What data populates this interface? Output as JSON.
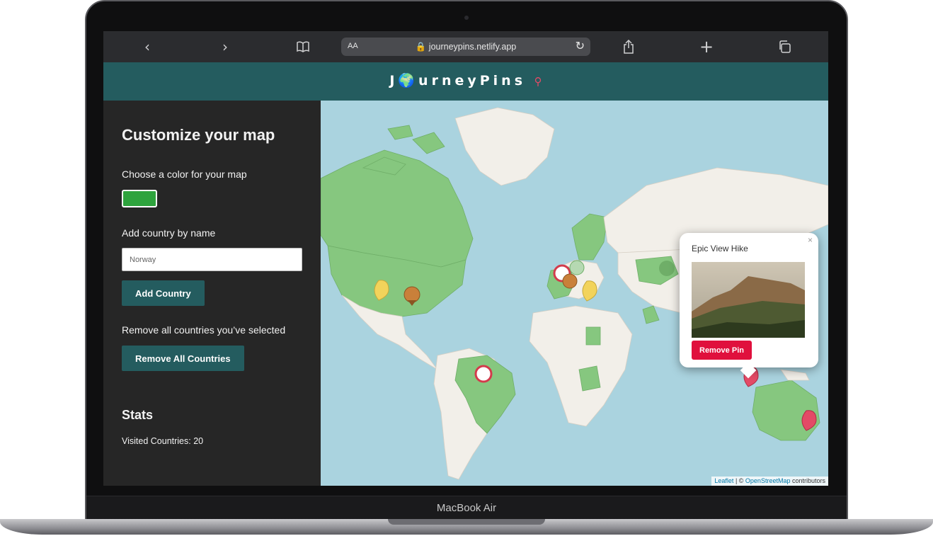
{
  "browser": {
    "text_size_label": "AA",
    "url": "journeypins.netlify.app",
    "icons": [
      "back-icon",
      "forward-icon",
      "bookmarks-icon",
      "lock-icon",
      "reload-icon",
      "share-icon",
      "new-tab-icon",
      "tabs-icon"
    ]
  },
  "header": {
    "logo_text": "J🌍urneyPins"
  },
  "sidebar": {
    "title": "Customize your map",
    "color_label": "Choose a color for your map",
    "map_color": "#2ea33d",
    "add_label": "Add country by name",
    "country_input_value": "Norway",
    "add_button": "Add Country",
    "remove_label": "Remove all countries you’ve selected",
    "remove_button": "Remove All Countries",
    "stats_title": "Stats",
    "visited_label": "Visited Countries: 20"
  },
  "map": {
    "visited_fill": "#86c77f",
    "water_color": "#aad3df",
    "popup": {
      "title": "Epic View Hike",
      "close": "×",
      "remove_button": "Remove Pin"
    },
    "attribution": {
      "leaflet": "Leaflet",
      "separator": " | © ",
      "osm": "OpenStreetMap",
      "suffix": " contributors"
    }
  },
  "device": {
    "label": "MacBook Air"
  }
}
